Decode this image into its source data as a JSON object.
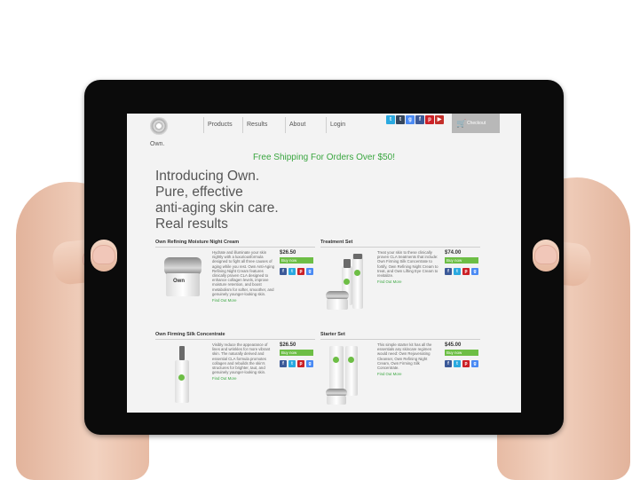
{
  "nav": {
    "logo_text": "Own.",
    "items": [
      "Products",
      "Results",
      "About",
      "Login"
    ],
    "checkout": "Checkout"
  },
  "social_icons": [
    "twitter-icon",
    "tumblr-icon",
    "google-plus-icon",
    "facebook-icon",
    "pinterest-icon",
    "youtube-icon"
  ],
  "banner": "Free Shipping For Orders Over $50!",
  "hero": {
    "line1": "Introducing Own.",
    "line2": "Pure, effective",
    "line3": "anti-aging skin care.",
    "line4": "Real results"
  },
  "products": [
    {
      "title": "Own Refining Moisture Night Cream",
      "description": "Hydrate and illuminate your skin nightly with a luxuriousformula designed to fight all three causes of aging while you rest. Own Anti-Aging Refining Night Cream features clinically proven CLA designed to enhance collagen levels, improve moisture retention, and boost metabolism for softer, smoother, and genuinely younger-looking skin.",
      "link": "Find Out More",
      "price": "$26.50",
      "buy": "Buy now"
    },
    {
      "title": "Treatment Set",
      "description": "Treat your skin to these clinically proven CLA treatments that include: Own Firming Silk Concentrate to fortify, Own Refining Night Cream to treat, and Own Lifting Eye Cream to revitalize.",
      "link": "Find Out More",
      "price": "$74.00",
      "buy": "Buy now"
    },
    {
      "title": "Own Firming Silk Concentrate",
      "description": "Visibly reduce the appearance of lines and wrinkles for more vibrant skin. The naturally derived and essential CLA formula promotes collagen and rebuilds the skin's structures for brighter, taut, and genuinely younger-looking skin.",
      "link": "Find Out More",
      "price": "$26.50",
      "buy": "Buy now"
    },
    {
      "title": "Starter Set",
      "description": "This simple starter kit has all the essentials any skincare regimen would need: Own Rejuvenating Cleanser, Own Refining Night Cream, Own Firming Silk Concentrate.",
      "link": "Find Out More",
      "price": "$45.00",
      "buy": "Buy now"
    }
  ],
  "share_icons": [
    "facebook-icon",
    "twitter-icon",
    "pinterest-icon",
    "google-plus-icon"
  ],
  "colors": {
    "accent_green": "#3aa640",
    "buy_green": "#6dbe45",
    "tablet_bezel": "#0b0b0b",
    "screen_bg": "#f3f3f3"
  }
}
